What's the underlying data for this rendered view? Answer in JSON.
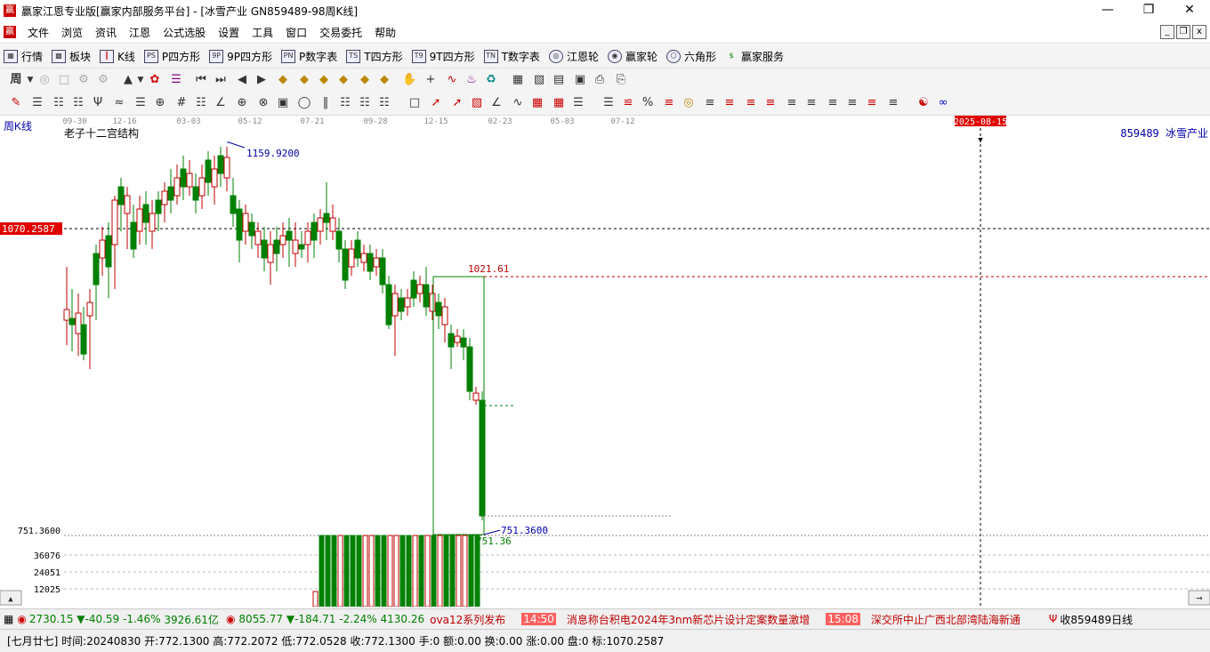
{
  "window": {
    "title": "赢家江恩专业版[赢家内部服务平台] - [冰雪产业  GN859489-98周K线]",
    "logo_char": "赢"
  },
  "menu": [
    "文件",
    "浏览",
    "资讯",
    "江恩",
    "公式选股",
    "设置",
    "工具",
    "窗口",
    "交易委托",
    "帮助"
  ],
  "toolbar1": [
    {
      "label": "行情",
      "icon": "grid-icon"
    },
    {
      "label": "板块",
      "icon": "blocks-icon"
    },
    {
      "label": "K线",
      "icon": "candlestick-icon"
    },
    {
      "label": "P四方形",
      "icon": "ps-icon",
      "code": "PS"
    },
    {
      "label": "9P四方形",
      "icon": "9p-icon",
      "code": "9P"
    },
    {
      "label": "P数字表",
      "icon": "pn-icon",
      "code": "PN"
    },
    {
      "label": "T四方形",
      "icon": "ts-icon",
      "code": "TS"
    },
    {
      "label": "9T四方形",
      "icon": "9t-icon",
      "code": "T9"
    },
    {
      "label": "T数字表",
      "icon": "tn-icon",
      "code": "TN"
    },
    {
      "label": "江恩轮",
      "icon": "wheel-icon"
    },
    {
      "label": "赢家轮",
      "icon": "wheel2-icon"
    },
    {
      "label": "六角形",
      "icon": "hexagon-icon"
    },
    {
      "label": "赢家服务",
      "icon": "dollar-icon"
    }
  ],
  "period_selector": "周",
  "chart": {
    "period_label": "周K线",
    "formula_name": "老子十二宫结构",
    "stock_label": "859489 冰雪产业",
    "date_marker": "2025-08-15",
    "x_ticks": [
      "09-30",
      "12-16",
      "03-03",
      "05-12",
      "07-21",
      "09-28",
      "12-15",
      "02-23",
      "05-03",
      "07-12"
    ],
    "high_label": "1159.9200",
    "box_top_label": "1021.61",
    "h_line_label": "1070.2587",
    "low_label": "751.3600",
    "low_label2": "751.36",
    "axis_low": "751.3600",
    "vol_ticks": [
      "36076",
      "24051",
      "12025"
    ]
  },
  "chart_data": {
    "type": "candlestick",
    "period": "weekly",
    "high": 1159.92,
    "low": 751.36,
    "reference_line": 1070.2587,
    "box_top": 1021.61
  },
  "status": {
    "idx1_value": "2730.15",
    "idx1_change": "▼-40.59",
    "idx1_pct": "-1.46%",
    "idx1_amount": "3926.61亿",
    "idx2_value": "8055.77",
    "idx2_change": "▼-184.71",
    "idx2_pct": "-2.24%",
    "idx2_amount": "4130.26",
    "news1": "ova12系列发布",
    "news2_time": "14:50",
    "news2": "消息称台积电2024年3nm新芯片设计定案数量激增",
    "news3_time": "15:08",
    "news3": "深交所中止广西北部湾陆海新通",
    "right": "收859489日线"
  },
  "info": "[七月廿七] 时间:20240830 开:772.1300 高:772.2072 低:772.0528 收:772.1300 手:0 额:0.00 换:0.00 涨:0.00 盘:0 标:1070.2587"
}
